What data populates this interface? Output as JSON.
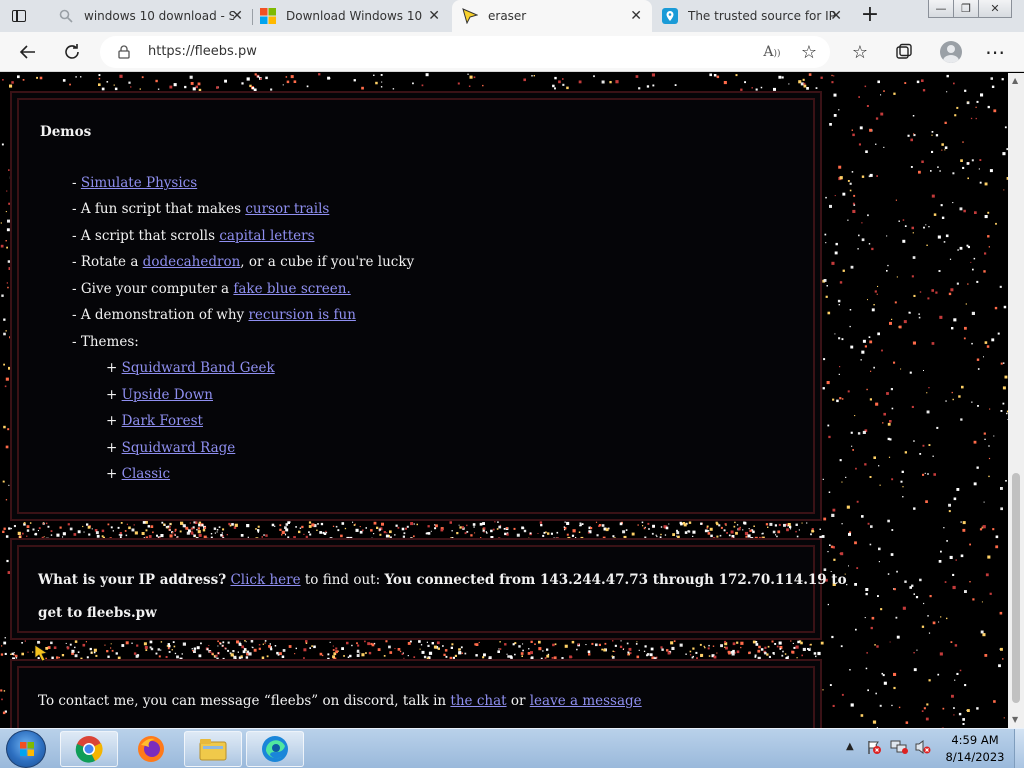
{
  "browser": {
    "tabs": [
      {
        "title": "windows 10 download - S",
        "icon": "search-icon"
      },
      {
        "title": "Download Windows 10",
        "icon": "microsoft-logo-icon"
      },
      {
        "title": "eraser",
        "icon": "cursor-icon",
        "active": true
      },
      {
        "title": "The trusted source for IP",
        "icon": "location-pin-icon"
      }
    ],
    "url": "https://fleebs.pw"
  },
  "page": {
    "demos": {
      "title": "Demos",
      "items": [
        {
          "pre": "- ",
          "link": "Simulate Physics",
          "post": ""
        },
        {
          "pre": "- A fun script that makes ",
          "link": "cursor trails",
          "post": ""
        },
        {
          "pre": "- A script that scrolls ",
          "link": "capital letters",
          "post": ""
        },
        {
          "pre": "- Rotate a ",
          "link": "dodecahedron",
          "post": ", or a cube if you're lucky"
        },
        {
          "pre": "- Give your computer a ",
          "link": "fake blue screen.",
          "post": ""
        },
        {
          "pre": "- A demonstration of why ",
          "link": "recursion is fun",
          "post": ""
        }
      ],
      "themes_label": "- Themes:",
      "themes": [
        "Squidward Band Geek",
        "Upside Down",
        "Dark Forest",
        "Squidward Rage",
        "Classic"
      ],
      "theme_bullet": "+"
    },
    "ip": {
      "question": "What is your IP address?",
      "link": "Click here",
      "middle": " to find out: ",
      "result_line1": "You connected from 143.244.47.73 through 172.70.114.19 to",
      "result_line2": "get to fleebs.pw"
    },
    "contact": {
      "pre": "To contact me, you can message “fleebs” on discord, talk in ",
      "link1": "the chat",
      "mid": " or ",
      "link2": "leave a message"
    }
  },
  "taskbar": {
    "time": "4:59 AM",
    "date": "8/14/2023"
  },
  "colors": {
    "link": "#8f8ff0",
    "panel_border": "#3a1216",
    "page_bg": "#000000"
  }
}
